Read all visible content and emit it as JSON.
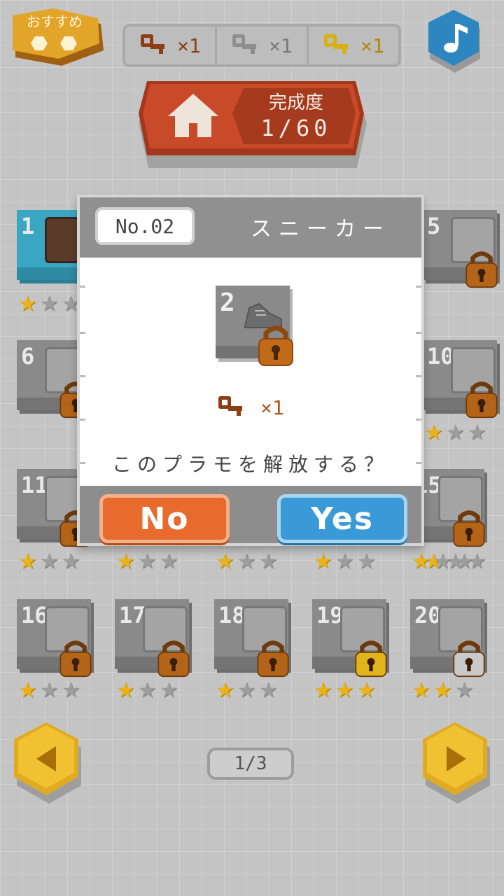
{
  "top": {
    "recommend_label": "おすすめ",
    "keys": [
      {
        "color": "#8c3f14",
        "count": "×1",
        "name": "bronze"
      },
      {
        "color": "#8e8e8e",
        "count": "×1",
        "name": "silver"
      },
      {
        "color": "#d8b010",
        "count": "×1",
        "name": "gold"
      }
    ],
    "music_icon": "music-note-icon",
    "home": {
      "label": "完成度",
      "value": "1/60",
      "icon": "home-icon"
    }
  },
  "tiles": [
    {
      "num": "1",
      "stars": 1,
      "locked": false,
      "lock_color": ""
    },
    {
      "num": "5",
      "stars": 1,
      "locked": true,
      "lock_color": "#b46418"
    },
    {
      "num": "6",
      "stars": 1,
      "locked": true,
      "lock_color": "#b46418"
    },
    {
      "num": "10",
      "stars": 1,
      "locked": true,
      "lock_color": "#b46418"
    },
    {
      "num": "11",
      "stars": 1,
      "locked": true,
      "lock_color": "#b46418"
    },
    {
      "num": "",
      "stars": 1,
      "locked": false,
      "lock_color": ""
    },
    {
      "num": "",
      "stars": 1,
      "locked": false,
      "lock_color": ""
    },
    {
      "num": "",
      "stars": 1,
      "locked": false,
      "lock_color": ""
    },
    {
      "num": "15",
      "stars": 1,
      "locked": true,
      "lock_color": "#b46418"
    },
    {
      "num": "16",
      "stars": 1,
      "locked": true,
      "lock_color": "#b46418"
    },
    {
      "num": "17",
      "stars": 1,
      "locked": true,
      "lock_color": "#b46418"
    },
    {
      "num": "18",
      "stars": 1,
      "locked": true,
      "lock_color": "#b46418"
    },
    {
      "num": "19",
      "stars": 3,
      "locked": true,
      "lock_color": "#e0b51c"
    },
    {
      "num": "20",
      "stars": 2,
      "locked": true,
      "lock_color": "#c9c9c9"
    }
  ],
  "modal": {
    "number": "No.02",
    "title": "スニーカー",
    "preview_num": "2",
    "cost": "×1",
    "question": "このプラモを解放する？",
    "no_label": "No",
    "yes_label": "Yes"
  },
  "pager": {
    "text": "1/3",
    "prev_icon": "triangle-left-icon",
    "next_icon": "triangle-right-icon"
  }
}
